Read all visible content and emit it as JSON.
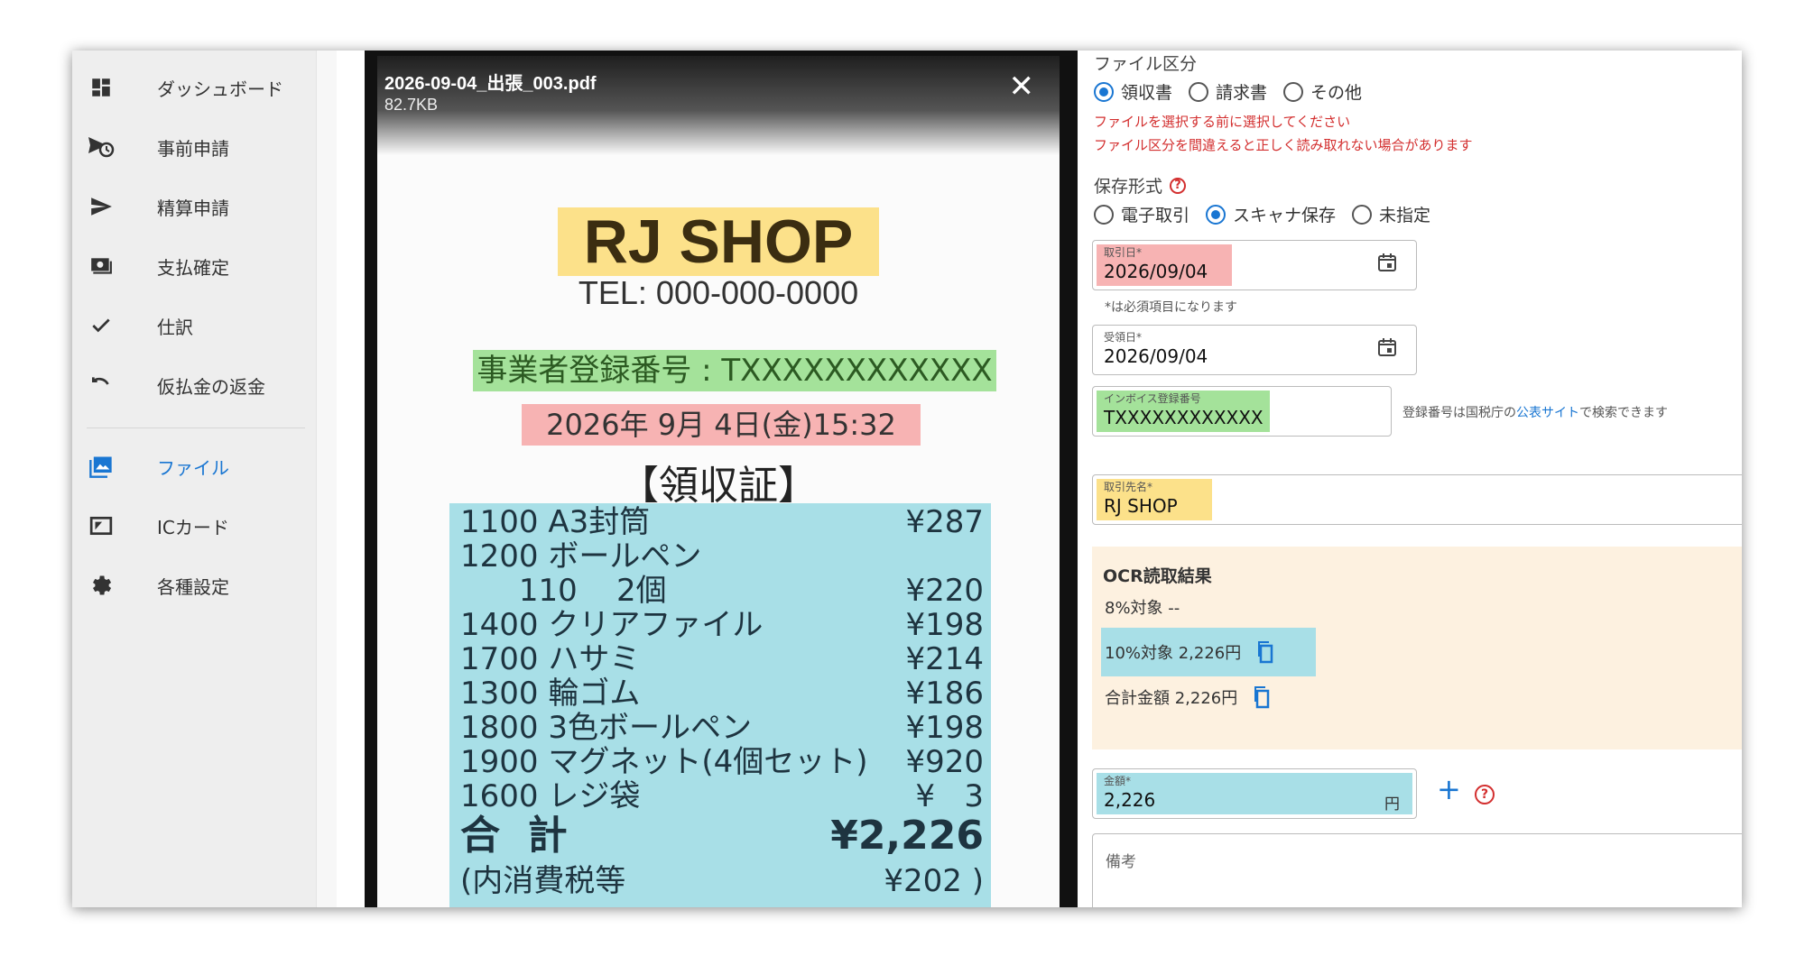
{
  "sidebar": {
    "items": [
      {
        "label": "ダッシュボード",
        "icon": "dashboard-icon"
      },
      {
        "label": "事前申請",
        "icon": "pre-application-icon"
      },
      {
        "label": "精算申請",
        "icon": "send-icon"
      },
      {
        "label": "支払確定",
        "icon": "payment-icon"
      },
      {
        "label": "仕訳",
        "icon": "check-icon"
      },
      {
        "label": "仮払金の返金",
        "icon": "undo-icon"
      },
      {
        "label": "ファイル",
        "icon": "image-icon",
        "active": true
      },
      {
        "label": "ICカード",
        "icon": "ic-card-icon"
      },
      {
        "label": "各種設定",
        "icon": "gear-icon"
      }
    ]
  },
  "preview": {
    "filename": "2026-09-04_出張_003.pdf",
    "filesize": "82.7KB",
    "close": "✕",
    "receipt": {
      "shop": "RJ SHOP",
      "tel": "TEL: 000-000-0000",
      "registration": "事業者登録番号 : TXXXXXXXXXXXX",
      "datetime": "2026年  9月  4日(金)15:32",
      "title": "【領収証】",
      "lines": [
        {
          "left": "1100 A3封筒",
          "right": "¥287"
        },
        {
          "left": "1200 ボールペン",
          "right": ""
        },
        {
          "left": "      110    2個",
          "right": "¥220"
        },
        {
          "left": "1400 クリアファイル",
          "right": "¥198"
        },
        {
          "left": "1700 ハサミ",
          "right": "¥214"
        },
        {
          "left": "1300 輪ゴム",
          "right": "¥186"
        },
        {
          "left": "1800 3色ボールペン",
          "right": "¥198"
        },
        {
          "left": "1900 マグネット(4個セット)",
          "right": "¥920"
        },
        {
          "left": "1600 レジ袋",
          "right": "¥   3"
        }
      ],
      "total_label": "合  計",
      "total_value": "¥2,226",
      "tax_label": "(内消費税等",
      "tax_value": "¥202 )"
    }
  },
  "form": {
    "file_type": {
      "label": "ファイル区分",
      "options": [
        "領収書",
        "請求書",
        "その他"
      ],
      "selected": "領収書",
      "warning1": "ファイルを選択する前に選択してください",
      "warning2": "ファイル区分を間違えると正しく読み取れない場合があります"
    },
    "save_format": {
      "label": "保存形式",
      "options": [
        "電子取引",
        "スキャナ保存",
        "未指定"
      ],
      "selected": "スキャナ保存"
    },
    "transaction_date": {
      "label": "取引日*",
      "value": "2026/09/04"
    },
    "required_hint": "*は必須項目になります",
    "received_date": {
      "label": "受領日*",
      "value": "2026/09/04"
    },
    "invoice": {
      "label": "インボイス登録番号",
      "value": "TXXXXXXXXXXXX",
      "hint_pre": "登録番号は国税庁の",
      "hint_link": "公表サイト",
      "hint_post": "で検索できます"
    },
    "vendor": {
      "label": "取引先名*",
      "value": "RJ SHOP"
    },
    "ocr": {
      "title": "OCR読取結果",
      "rate8": "8%対象  --",
      "rate10": "10%対象 2,226円",
      "total": "合計金額 2,226円"
    },
    "amount": {
      "label": "金額*",
      "value": "2,226",
      "unit": "円",
      "plus": "+"
    },
    "note": {
      "label": "備考"
    }
  },
  "colors": {
    "accent": "#1976d2",
    "warning": "#d32f2f",
    "highlight_yellow": "#fce18a",
    "highlight_green": "#a4e29a",
    "highlight_red": "#f7b3b3",
    "highlight_cyan": "#a8dfe7",
    "ocr_panel": "#fdf1e0"
  }
}
